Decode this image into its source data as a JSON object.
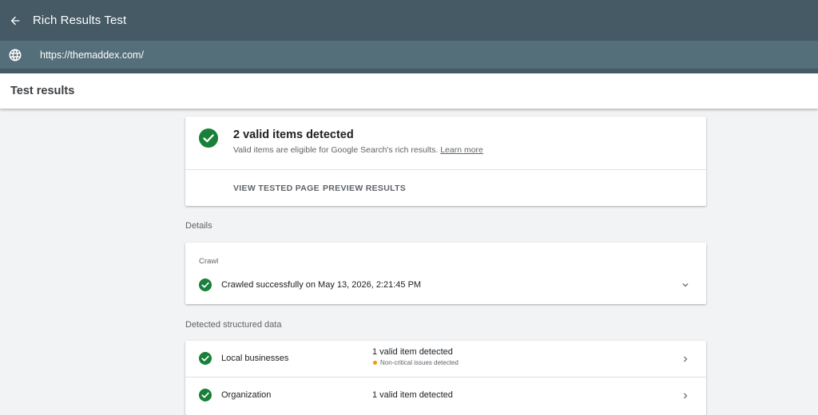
{
  "app": {
    "title": "Rich Results Test"
  },
  "url_bar": {
    "url": "https://themaddex.com/"
  },
  "results_header": {
    "title": "Test results"
  },
  "summary": {
    "title": "2 valid items detected",
    "subtitle": "Valid items are eligible for Google Search's rich results.",
    "learn_more": "Learn more",
    "actions": [
      "VIEW TESTED PAGE",
      "PREVIEW RESULTS"
    ]
  },
  "details": {
    "label": "Details",
    "crawl": {
      "label": "Crawl",
      "status": "Crawled successfully on May 13, 2026, 2:21:45 PM"
    }
  },
  "structured_data": {
    "label": "Detected structured data",
    "items": [
      {
        "name": "Local businesses",
        "status": "1 valid item detected",
        "note": "Non-critical issues detected"
      },
      {
        "name": "Organization",
        "status": "1 valid item detected"
      }
    ]
  },
  "colors": {
    "header": "#455a64",
    "url_bar": "#546e7a",
    "valid_green": "#188038",
    "warning": "#f29900"
  }
}
